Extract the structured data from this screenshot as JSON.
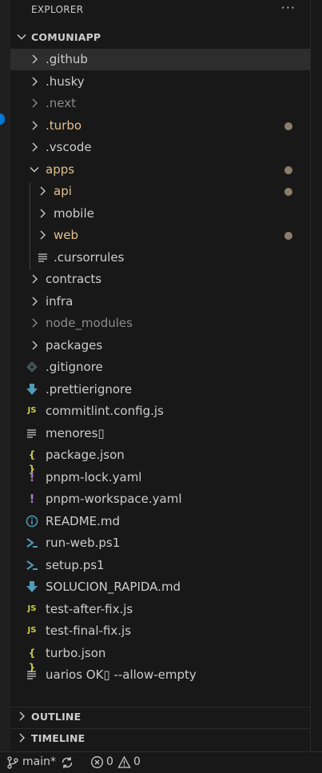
{
  "explorer": {
    "title": "EXPLORER",
    "more_icon": "more-icon"
  },
  "project": {
    "name": "COMUNIAPP"
  },
  "tree": {
    "github": ".github",
    "husky": ".husky",
    "next": ".next",
    "turbo": ".turbo",
    "vscode": ".vscode",
    "apps": "apps",
    "api": "api",
    "mobile": "mobile",
    "web": "web",
    "cursorrules": ".cursorrules",
    "contracts": "contracts",
    "infra": "infra",
    "node_modules": "node_modules",
    "packages": "packages",
    "gitignore": ".gitignore",
    "prettierignore": ".prettierignore",
    "commitlint": "commitlint.config.js",
    "menores": "menores▯",
    "package_json": "package.json",
    "pnpm_lock": "pnpm-lock.yaml",
    "pnpm_workspace": "pnpm-workspace.yaml",
    "readme": "README.md",
    "run_web": "run-web.ps1",
    "setup": "setup.ps1",
    "solucion": "SOLUCION_RAPIDA.md",
    "test_after": "test-after-fix.js",
    "test_final": "test-final-fix.js",
    "turbo_json": "turbo.json",
    "uarios": "uarios OK▯ --allow-empty"
  },
  "icons": {
    "js": "JS",
    "json": "{ }",
    "yaml": "!",
    "info": "i"
  },
  "sections": {
    "outline": "OUTLINE",
    "timeline": "TIMELINE"
  },
  "status": {
    "branch": "main*",
    "errors": "0",
    "warnings": "0"
  },
  "colors": {
    "modified": "#e2c08d",
    "ignored": "#8c8c8c",
    "js_icon": "#cbcb41",
    "json_icon": "#cbcb41",
    "yaml_icon": "#a074c4",
    "ps_icon": "#519aba",
    "info_icon": "#519aba",
    "accent": "#0078d4"
  }
}
